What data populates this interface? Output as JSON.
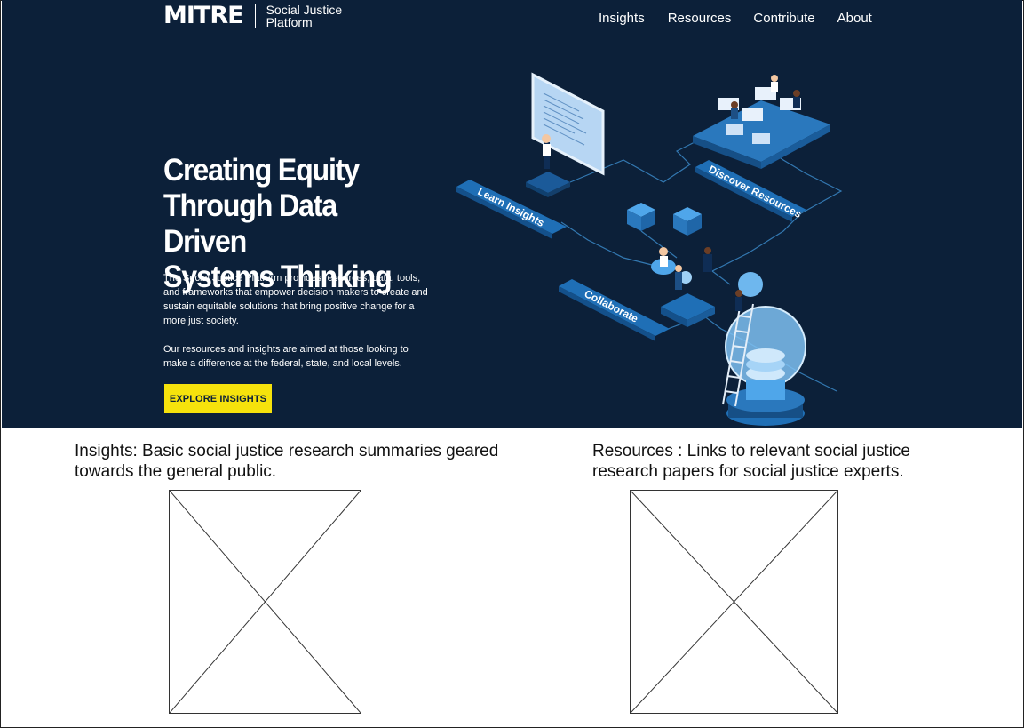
{
  "header": {
    "logo_text": "MITRE",
    "logo_sub_line1": "Social Justice",
    "logo_sub_line2": "Platform",
    "nav": [
      "Insights",
      "Resources",
      "Contribute",
      "About"
    ]
  },
  "hero": {
    "headline_line1": "Creating Equity",
    "headline_line2": "Through Data Driven",
    "headline_line3": "Systems Thinking",
    "paragraph1": "The Social Justice Platform provides resources, data, tools, and frameworks that empower decision makers to create and sustain equitable solutions that bring positive change for a more just society.",
    "paragraph2": "Our resources and insights are aimed at those looking to make a difference at the federal, state, and local levels.",
    "cta_label": "EXPLORE INSIGHTS",
    "illustration_labels": {
      "learn": "Learn Insights",
      "discover": "Discover Resources",
      "collaborate": "Collaborate"
    }
  },
  "sections": {
    "insights_text": "Insights:  Basic social justice research summaries geared towards the general public.",
    "resources_text": "Resources : Links to relevant social justice research papers for social justice experts."
  },
  "colors": {
    "hero_bg": "#0c2039",
    "cta_bg": "#f6e20c",
    "accent_blue": "#2d7fc1"
  }
}
